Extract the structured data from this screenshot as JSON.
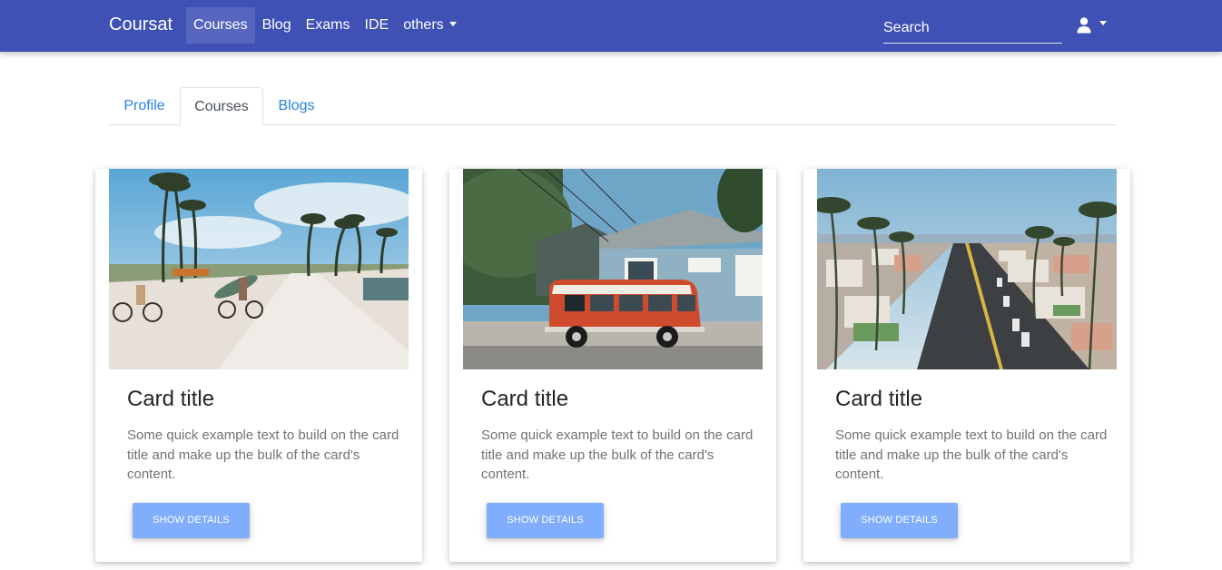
{
  "navbar": {
    "brand": "Coursat",
    "links": [
      {
        "label": "Courses",
        "active": true
      },
      {
        "label": "Blog"
      },
      {
        "label": "Exams"
      },
      {
        "label": "IDE"
      },
      {
        "label": "others"
      }
    ],
    "search_placeholder": "Search",
    "user_icon": "user-icon",
    "bg_color": "#3f51b5"
  },
  "tabs": [
    {
      "label": "Profile"
    },
    {
      "label": "Courses",
      "active": true
    },
    {
      "label": "Blogs"
    }
  ],
  "cards": [
    {
      "title": "Card title",
      "text": "Some quick example text to build on the card title and make up the bulk of the card's content.",
      "button": "SHOW DETAILS",
      "image": "beach-boardwalk-photo"
    },
    {
      "title": "Card title",
      "text": "Some quick example text to build on the card title and make up the bulk of the card's content.",
      "button": "SHOW DETAILS",
      "image": "red-van-house-photo"
    },
    {
      "title": "Card title",
      "text": "Some quick example text to build on the card title and make up the bulk of the card's content.",
      "button": "SHOW DETAILS",
      "image": "palm-street-aerial-photo"
    }
  ],
  "colors": {
    "accent": "#3f51b5",
    "link": "#2581e8",
    "button": "#80aefc"
  }
}
